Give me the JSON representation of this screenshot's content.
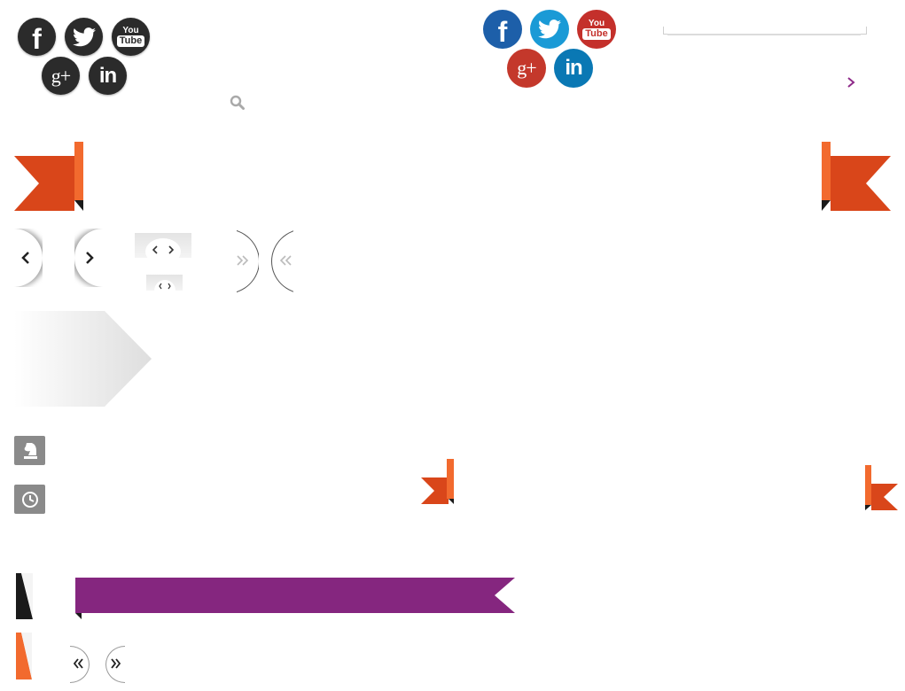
{
  "social_dark": {
    "facebook": "f",
    "twitter": "twitter-bird",
    "youtube_top": "You",
    "youtube_bottom": "Tube",
    "googleplus": "g+",
    "linkedin": "in"
  },
  "social_color": {
    "facebook": "f",
    "twitter": "twitter-bird",
    "youtube_top": "You",
    "youtube_bottom": "Tube",
    "googleplus": "g+",
    "linkedin": "in"
  },
  "search": {
    "placeholder": ""
  },
  "icons": {
    "search": "search-icon",
    "chevron_right": "chevron-right-icon",
    "chevron_left": "chevron-left-icon",
    "double_chevron_right": "double-chevron-right-icon",
    "double_chevron_left": "double-chevron-left-icon",
    "chess_knight": "chess-knight-icon",
    "clock": "clock-icon"
  },
  "colors": {
    "orange": "#d9461a",
    "orange_light": "#f26a2e",
    "purple": "#85267f",
    "dark_icon": "#2b2b2b",
    "facebook_blue": "#1d5fa9",
    "twitter_blue": "#1a9ad6",
    "youtube_red": "#c4302b",
    "gplus_red": "#c4382b",
    "linkedin_blue": "#0a78b4",
    "grey_tile": "#8a8a8a"
  }
}
